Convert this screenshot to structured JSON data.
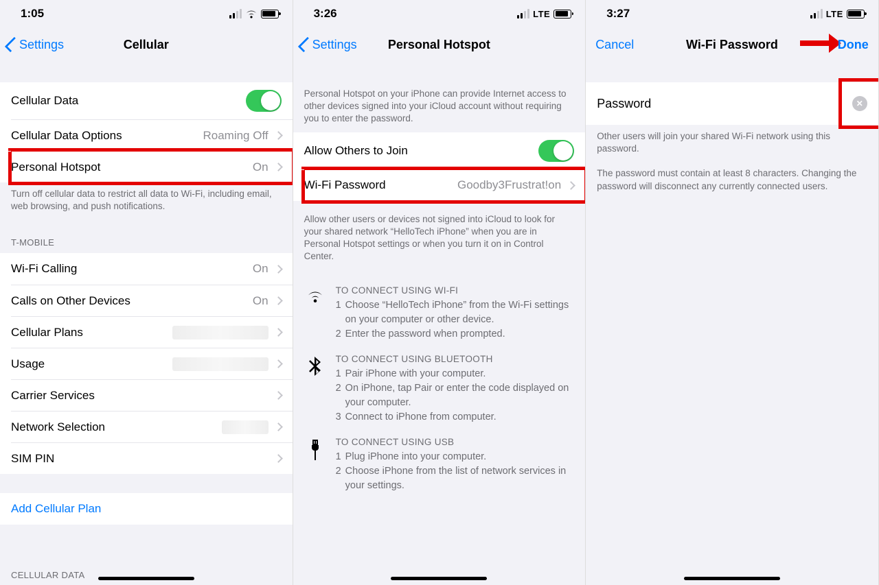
{
  "s1": {
    "time": "1:05",
    "signal_type": "wifi",
    "back": "Settings",
    "title": "Cellular",
    "rows": {
      "cellular_data": "Cellular Data",
      "cellular_options": "Cellular Data Options",
      "cellular_options_val": "Roaming Off",
      "hotspot": "Personal Hotspot",
      "hotspot_val": "On",
      "footer1": "Turn off cellular data to restrict all data to Wi-Fi, including email, web browsing, and push notifications.",
      "carrier_header": "T-MOBILE",
      "wifi_calling": "Wi-Fi Calling",
      "wifi_calling_val": "On",
      "calls_other": "Calls on Other Devices",
      "calls_other_val": "On",
      "plans": "Cellular Plans",
      "usage": "Usage",
      "carrier_services": "Carrier Services",
      "network_selection": "Network Selection",
      "sim_pin": "SIM PIN",
      "add_plan": "Add Cellular Plan",
      "footer2_header": "CELLULAR DATA"
    }
  },
  "s2": {
    "time": "3:26",
    "lte": "LTE",
    "back": "Settings",
    "title": "Personal Hotspot",
    "desc1": "Personal Hotspot on your iPhone can provide Internet access to other devices signed into your iCloud account without requiring you to enter the password.",
    "allow": "Allow Others to Join",
    "wifi_pw": "Wi-Fi Password",
    "wifi_pw_val": "Goodby3Frustrat!on",
    "desc2": "Allow other users or devices not signed into iCloud to look for your shared network “HelloTech iPhone” when you are in Personal Hotspot settings or when you turn it on in Control Center.",
    "wifi_head": "TO CONNECT USING WI-FI",
    "wifi_step1": "Choose “HelloTech iPhone” from the Wi-Fi settings on your computer or other device.",
    "wifi_step2": "Enter the password when prompted.",
    "bt_head": "TO CONNECT USING BLUETOOTH",
    "bt_step1": "Pair iPhone with your computer.",
    "bt_step2": "On iPhone, tap Pair or enter the code displayed on your computer.",
    "bt_step3": "Connect to iPhone from computer.",
    "usb_head": "TO CONNECT USING USB",
    "usb_step1": "Plug iPhone into your computer.",
    "usb_step2": "Choose iPhone from the list of network services in your settings."
  },
  "s3": {
    "time": "3:27",
    "lte": "LTE",
    "cancel": "Cancel",
    "title": "Wi-Fi Password",
    "done": "Done",
    "pw_label": "Password",
    "footer1": "Other users will join your shared Wi-Fi network using this password.",
    "footer2": "The password must contain at least 8 characters. Changing the password will disconnect any currently connected users."
  }
}
